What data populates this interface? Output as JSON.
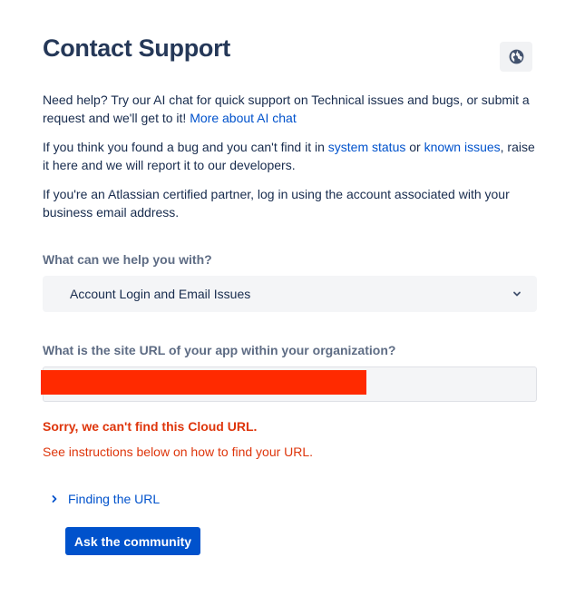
{
  "header": {
    "title": "Contact Support",
    "language_icon": "globe-icon"
  },
  "intro": {
    "p1_text": "Need help? Try our AI chat for quick support on Technical issues and bugs, or submit a request and we'll get to it! ",
    "p1_link": "More about AI chat",
    "p2_before": "If you think you found a bug and you can't find it in ",
    "p2_link1": "system status",
    "p2_between": " or ",
    "p2_link2": "known issues",
    "p2_after": ", raise it here and we will report it to our developers.",
    "p3_text": "If you're an Atlassian certified partner, log in using the account associated with your business email address."
  },
  "help_topic": {
    "label": "What can we help you with?",
    "selected_value": "Account Login and Email Issues",
    "chevron_icon": "chevron-down-icon"
  },
  "site_url": {
    "label": "What is the site URL of your app within your organization?",
    "value_redacted": true,
    "error_title": "Sorry, we can't find this Cloud URL.",
    "error_text": "See instructions below on how to find your URL."
  },
  "finding_url": {
    "label": "Finding the URL",
    "chevron_icon": "chevron-right-icon"
  },
  "actions": {
    "community_button": "Ask the community"
  },
  "colors": {
    "link": "#0052cc",
    "error": "#de350b",
    "primary_button": "#0052cc",
    "redaction": "#ff2a00"
  }
}
